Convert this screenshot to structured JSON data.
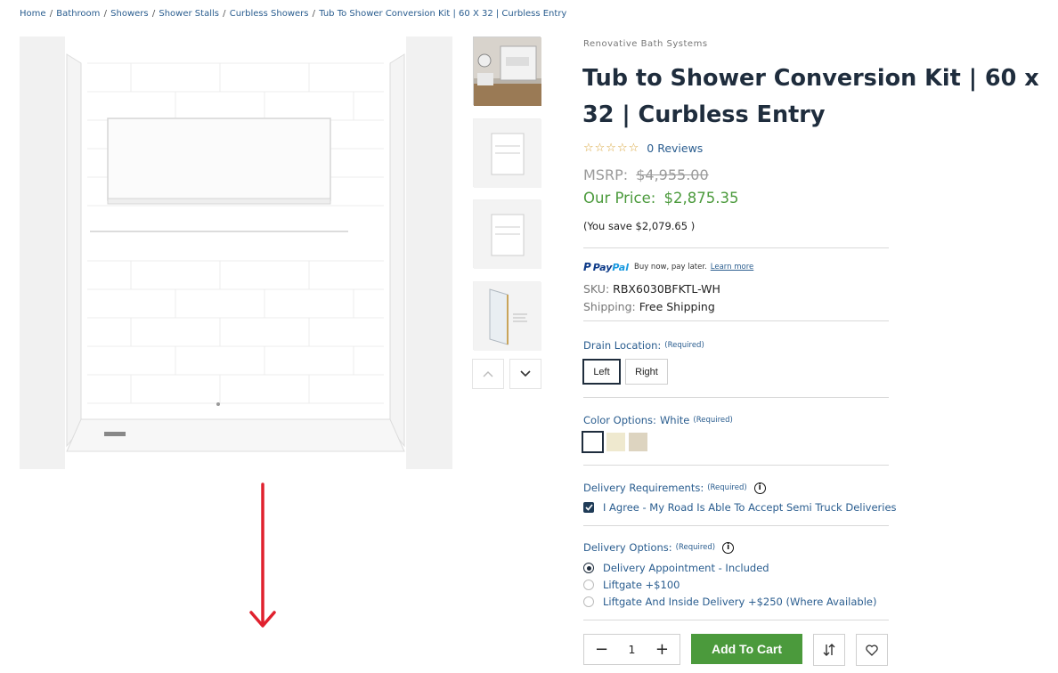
{
  "breadcrumb": {
    "items": [
      "Home",
      "Bathroom",
      "Showers",
      "Shower Stalls",
      "Curbless Showers",
      "Tub To Shower Conversion Kit | 60 X 32 | Curbless Entry"
    ],
    "separator": "/"
  },
  "product": {
    "brand": "Renovative Bath Systems",
    "title": "Tub to Shower Conversion Kit | 60 x 32 | Curbless Entry",
    "rating_stars": "☆☆☆☆☆",
    "reviews": "0 Reviews",
    "msrp_label": "MSRP:",
    "msrp_value": "$4,955.00",
    "price_label": "Our Price:",
    "price_value": "$2,875.35",
    "savings": "(You save $2,079.65 )"
  },
  "paypal": {
    "logo_p": "P",
    "logo_pay": "Pay",
    "logo_pal": "Pal",
    "text": "Buy now, pay later.",
    "link": "Learn more"
  },
  "specs": {
    "sku_label": "SKU:",
    "sku_value": "RBX6030BFKTL-WH",
    "shipping_label": "Shipping:",
    "shipping_value": "Free Shipping"
  },
  "drain": {
    "label": "Drain Location:",
    "required": "(Required)",
    "options": [
      "Left",
      "Right"
    ],
    "selected": "Left"
  },
  "color": {
    "label": "Color Options:",
    "selected_name": "White",
    "required": "(Required)",
    "swatches": [
      "#ffffff",
      "#efe9cf",
      "#ddd4c0"
    ]
  },
  "delivery_requirements": {
    "label": "Delivery Requirements:",
    "required": "(Required)",
    "info_icon": "i",
    "agree_text": "I Agree - My Road Is Able To Accept Semi Truck Deliveries",
    "checked": true
  },
  "delivery_options": {
    "label": "Delivery Options:",
    "required": "(Required)",
    "info_icon": "i",
    "options": [
      "Delivery Appointment - Included",
      "Liftgate +$100",
      "Liftgate And Inside Delivery +$250 (Where Available)"
    ],
    "selected_index": 0
  },
  "cart": {
    "minus": "−",
    "quantity": "1",
    "plus": "+",
    "add_label": "Add To Cart"
  },
  "colors": {
    "accent_green": "#4b9a3c",
    "link_blue": "#2a5d8f",
    "navy": "#1f2d3d",
    "arrow_red": "#e0212e"
  },
  "icons": {
    "compare": "compare-icon",
    "wishlist": "heart-icon",
    "thumb_up": "chevron-up-icon",
    "thumb_down": "chevron-down-icon"
  }
}
